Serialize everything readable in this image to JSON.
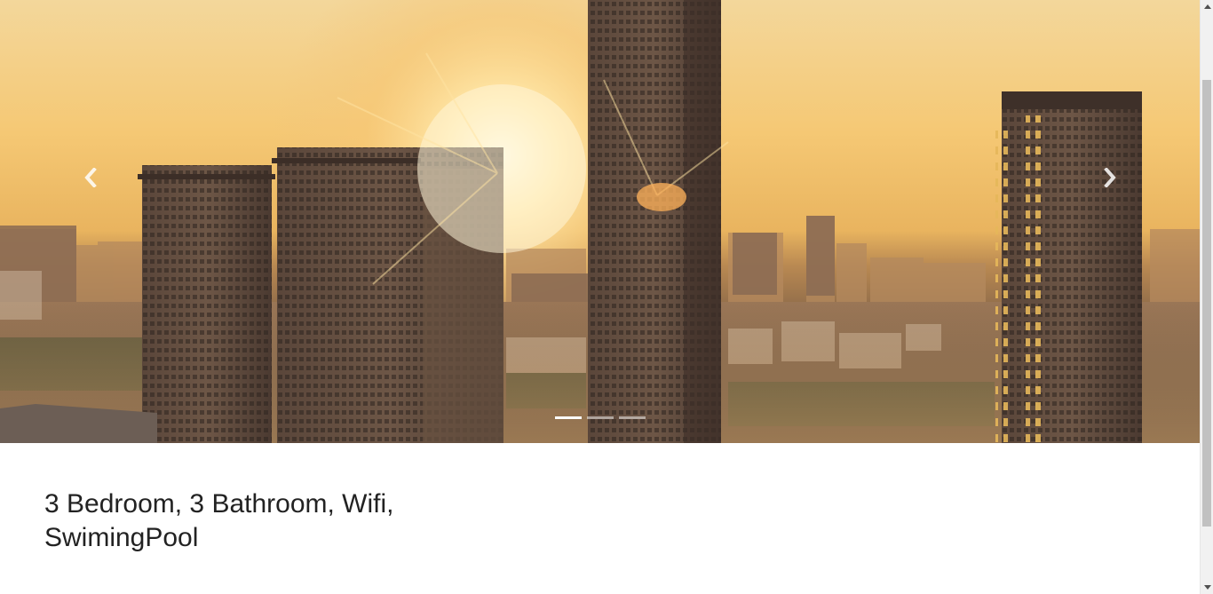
{
  "carousel": {
    "slide_count": 3,
    "active_index": 0,
    "image": "city-sunset-skyline",
    "prev_icon": "chevron-left-icon",
    "next_icon": "chevron-right-icon"
  },
  "listing": {
    "title": "3 Bedroom, 3 Bathroom, Wifi, SwimingPool"
  },
  "colors": {
    "sky_top": "#f3d79b",
    "sky_glow": "#f5c874",
    "building": "#4a3930",
    "indicator_active": "#ffffff",
    "text": "#222222"
  }
}
